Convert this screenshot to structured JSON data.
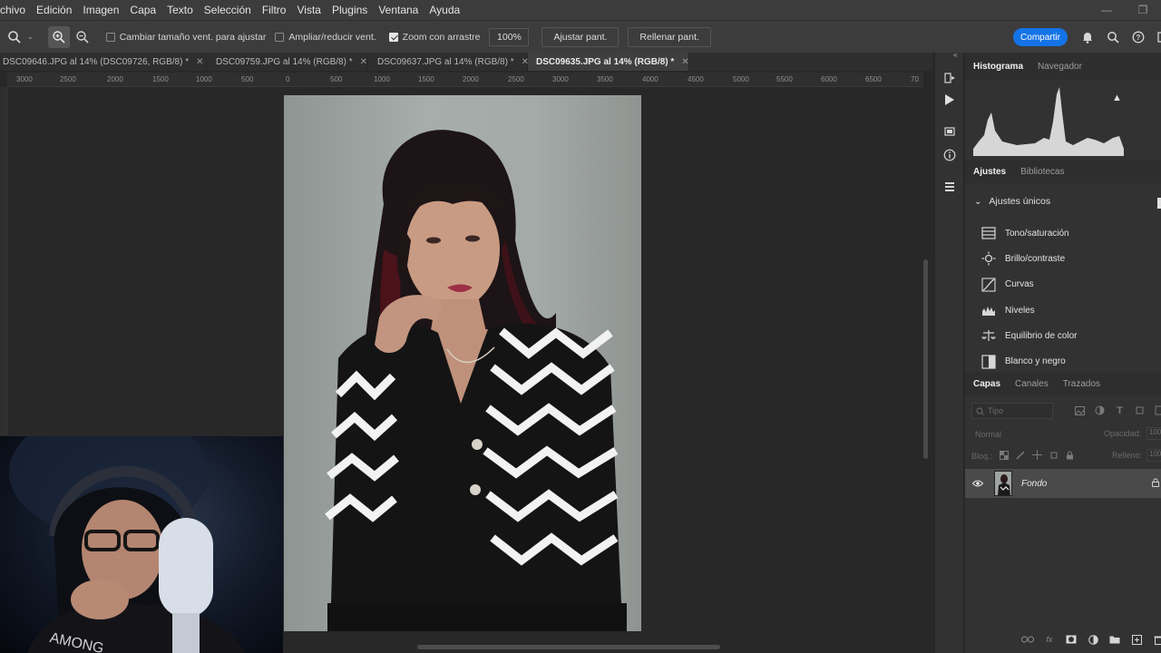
{
  "menu": [
    "chivo",
    "Edición",
    "Imagen",
    "Capa",
    "Texto",
    "Selección",
    "Filtro",
    "Vista",
    "Plugins",
    "Ventana",
    "Ayuda"
  ],
  "options": {
    "resize_label": "Cambiar tamaño vent. para ajustar",
    "zoom_all_label": "Ampliar/reducir vent.",
    "scrubby_label": "Zoom con arrastre",
    "zoom_value": "100%",
    "fit_label": "Ajustar pant.",
    "fill_label": "Rellenar pant.",
    "share_label": "Compartir"
  },
  "tabs": [
    {
      "label": "DSC09646.JPG al 14% (DSC09726, RGB/8) *",
      "active": false
    },
    {
      "label": "DSC09759.JPG al 14% (RGB/8) *",
      "active": false
    },
    {
      "label": "DSC09637.JPG al 14% (RGB/8) *",
      "active": false
    },
    {
      "label": "DSC09635.JPG al 14% (RGB/8) *",
      "active": true
    }
  ],
  "ruler_ticks": [
    "3000",
    "2500",
    "2000",
    "1500",
    "1000",
    "500",
    "0",
    "500",
    "1000",
    "1500",
    "2000",
    "2500",
    "3000",
    "3500",
    "4000",
    "4500",
    "5000",
    "5500",
    "6000",
    "6500",
    "70"
  ],
  "histogram": {
    "tab_active": "Histograma",
    "tab_other": "Navegador"
  },
  "adjustments": {
    "tab_active": "Ajustes",
    "tab_other": "Bibliotecas",
    "section": "Ajustes únicos",
    "items": [
      {
        "label": "Tono/saturación",
        "icon": "hue-saturation-icon"
      },
      {
        "label": "Brillo/contraste",
        "icon": "brightness-icon"
      },
      {
        "label": "Curvas",
        "icon": "curves-icon"
      },
      {
        "label": "Niveles",
        "icon": "levels-icon"
      },
      {
        "label": "Equilibrio de color",
        "icon": "color-balance-icon"
      },
      {
        "label": "Blanco y negro",
        "icon": "black-white-icon"
      }
    ]
  },
  "layers": {
    "tab_active": "Capas",
    "tab_channels": "Canales",
    "tab_paths": "Trazados",
    "search_placeholder": "Tipo",
    "blend_mode": "Normal",
    "opacity_label": "Opacidad:",
    "opacity_value": "100",
    "lock_label": "Bloq.:",
    "fill_label": "Relleno:",
    "fill_value": "100",
    "layer_name": "Fondo"
  },
  "colors": {
    "accent": "#1473e6",
    "panel": "#323232",
    "bar": "#3c3c3c"
  }
}
